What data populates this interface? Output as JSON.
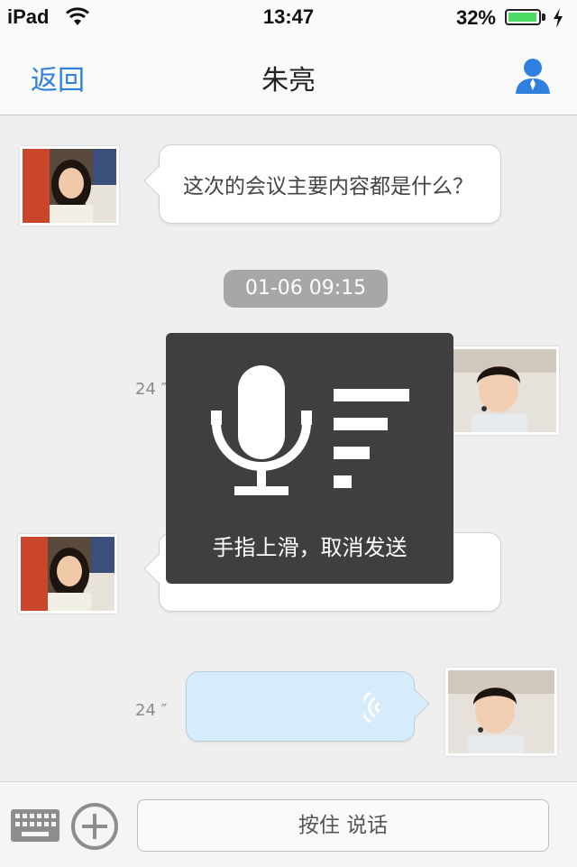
{
  "status_bar": {
    "carrier": "iPad",
    "time": "13:47",
    "battery_percent": "32%",
    "battery_level": 0.32,
    "icons": [
      "wifi-icon",
      "battery-icon",
      "charging-icon"
    ]
  },
  "nav": {
    "back_label": "返回",
    "title": "朱亮",
    "profile_icon": "person-icon"
  },
  "messages": [
    {
      "side": "left",
      "type": "text",
      "text": "这次的会议主要内容都是什么？"
    },
    {
      "side": "right",
      "type": "voice",
      "duration": "24 ″"
    },
    {
      "side": "left",
      "type": "text",
      "text": ""
    },
    {
      "side": "right",
      "type": "voice",
      "duration": "24 ″"
    }
  ],
  "timestamp": "01-06 09:15",
  "recording_overlay": {
    "hint": "手指上滑，取消发送",
    "icons": [
      "microphone-icon",
      "volume-level-icon"
    ]
  },
  "input_bar": {
    "hold_to_talk_label": "按住 说话",
    "icons": [
      "keyboard-icon",
      "plus-circle-icon"
    ]
  },
  "colors": {
    "accent": "#2f7fdf",
    "voice_bubble": "#d7ecfa",
    "overlay": "#3f3f3f",
    "timestamp_bg": "#a7a7a7"
  }
}
